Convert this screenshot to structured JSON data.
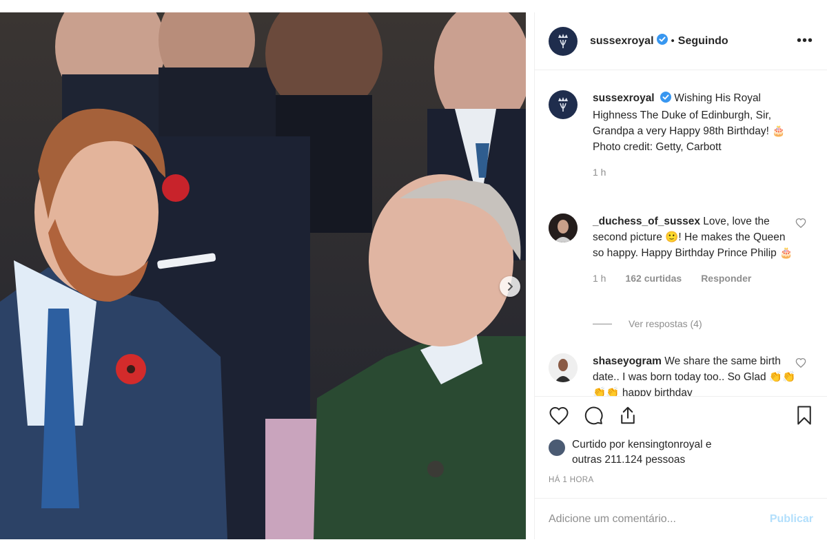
{
  "post": {
    "username": "sussexroyal",
    "separator": "•",
    "follow_status": "Seguindo",
    "more_label": "•••"
  },
  "caption": {
    "username": "sussexroyal",
    "text": "Wishing His Royal Highness The Duke of Edinburgh, Sir, Grandpa a very Happy 98th Birthday! 🎂",
    "credit": "Photo credit: Getty, Carbott",
    "time": "1 h"
  },
  "comments": [
    {
      "username": "_duchess_of_sussex",
      "text": "Love, love the second picture 🙂! He makes the Queen so happy. Happy Birthday Prince Philip 🎂",
      "time": "1 h",
      "likes": "162 curtidas",
      "reply": "Responder",
      "view_replies": "Ver respostas (4)"
    },
    {
      "username": "shaseyogram",
      "text": "We share the same birth date.. I was born today too.. So Glad 👏👏👏👏 happy birthday",
      "time": ""
    }
  ],
  "likes": {
    "line1": "Curtido por kensingtonroyal e",
    "line2": "outras 211.124 pessoas"
  },
  "timestamp": "HÁ 1 HORA",
  "add_comment": {
    "placeholder": "Adicione um comentário...",
    "publish": "Publicar"
  },
  "icons": {
    "like": "heart-icon",
    "comment": "comment-icon",
    "share": "share-icon",
    "save": "bookmark-icon",
    "verified": "verified-badge-icon",
    "next": "chevron-right-icon"
  },
  "carousel": {
    "slides": 2,
    "current": 1
  },
  "colors": {
    "verified": "#3897f0",
    "publish_disabled": "#b2dffc",
    "meta_gray": "#8e8e8e",
    "crest_navy": "#1f2d4d"
  }
}
